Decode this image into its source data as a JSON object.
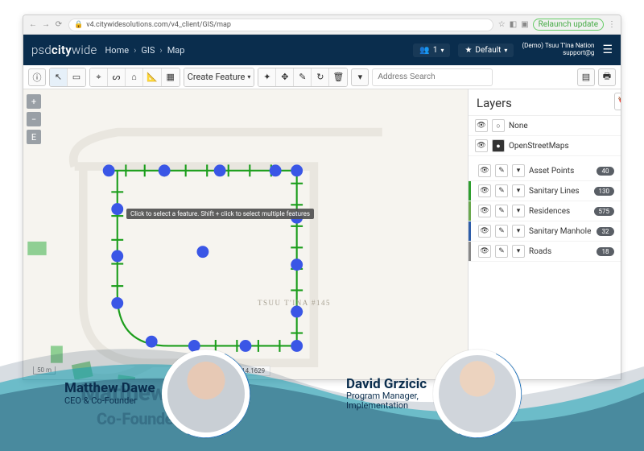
{
  "chrome": {
    "url": "v4.citywidesolutions.com/v4_client/GIS/map",
    "relaunch": "Relaunch update"
  },
  "header": {
    "logo_a": "psd",
    "logo_b": "city",
    "logo_c": "wide",
    "users_count": "1",
    "default_label": "Default",
    "demo_line1": "(Demo) Tsuu T'ina Nation",
    "demo_line2": "support@g"
  },
  "breadcrumbs": {
    "items": [
      "Home",
      "GIS",
      "Map"
    ]
  },
  "toolbar": {
    "create_feature": "Create Feature",
    "search_placeholder": "Address Search"
  },
  "sidebar_buttons": [
    "+",
    "−",
    "E"
  ],
  "map": {
    "tooltip": "Click to select a feature. Shift + click to select multiple features",
    "coords": "50, -114.1629",
    "scale": "50 m",
    "area_name": "TSUU T'INA #145"
  },
  "layers": {
    "title": "Layers",
    "base": [
      {
        "label": "None"
      },
      {
        "label": "OpenStreetMaps"
      }
    ],
    "items": [
      {
        "label": "Asset Points",
        "count": "40",
        "color": "#e08a2e"
      },
      {
        "label": "Sanitary Lines",
        "count": "130",
        "color": "#2e9e2e"
      },
      {
        "label": "Residences",
        "count": "575",
        "color": "#6aa84f"
      },
      {
        "label": "Sanitary Manhole",
        "count": "32",
        "color": "#2e5da8"
      },
      {
        "label": "Roads",
        "count": "18",
        "color": "#888888"
      }
    ]
  },
  "people": {
    "p1": {
      "name": "Matthew Dawe",
      "title": "CEO & Co-Founder"
    },
    "p2": {
      "name": "David Grzicic",
      "title1": "Program Manager,",
      "title2": "Implementation"
    },
    "ghost_name": "Matthew Dawe",
    "ghost_title": "Co-Founder and CEO"
  }
}
